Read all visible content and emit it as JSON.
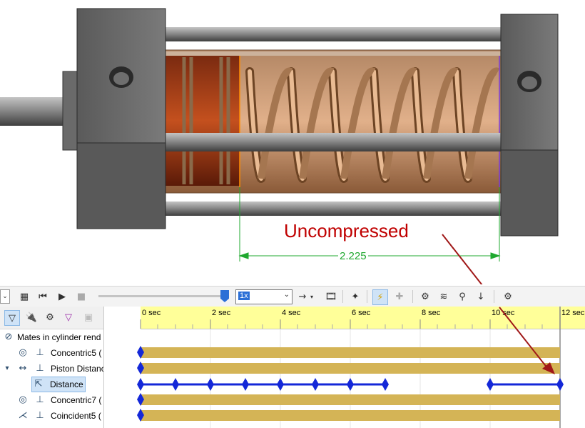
{
  "annotation": {
    "text": "Uncompressed",
    "color": "#c00000"
  },
  "dimension": {
    "value": "2.225",
    "color": "#1fa82f"
  },
  "toolbar": {
    "speed": "1x",
    "icons": [
      "calculate-icon",
      "play-from-start-icon",
      "play-icon",
      "stop-icon",
      "arrow-right-icon",
      "save-animation-icon",
      "animation-wizard-icon",
      "autokey-icon",
      "add-key-icon",
      "motor-icon",
      "spring-icon",
      "contact-icon",
      "gravity-icon",
      "study-properties-icon"
    ]
  },
  "tree": {
    "filter_icons": [
      "filter-icon",
      "filter-driving-icon",
      "filter-selected-icon",
      "filter-results-icon",
      "auto-update-icon"
    ],
    "items": [
      {
        "label": "Mates in cylinder rend",
        "icon": "mates-folder-icon"
      },
      {
        "label": "Concentric5 (",
        "icon": "concentric-mate-icon"
      },
      {
        "label": "Piston Distanc",
        "icon": "distance-mate-icon"
      },
      {
        "label": "Distance",
        "icon": "distance-dimension-icon",
        "selected": true
      },
      {
        "label": "Concentric7 (",
        "icon": "concentric-mate-icon"
      },
      {
        "label": "Coincident5 (",
        "icon": "coincident-mate-icon"
      }
    ]
  },
  "timeline": {
    "tick_labels": [
      "0 sec",
      "2 sec",
      "4 sec",
      "6 sec",
      "8 sec",
      "10 sec",
      "12 sec"
    ],
    "keyframe_color": "#1428d8",
    "bar_color": "#d4b456"
  }
}
